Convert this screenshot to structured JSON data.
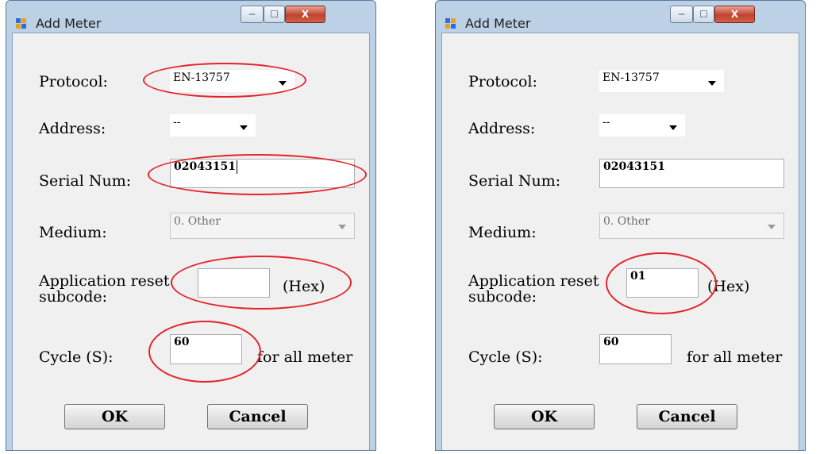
{
  "windows": [
    {
      "title": "Add Meter",
      "controls": {
        "minimize": "─",
        "maximize": "☐",
        "close": "X"
      },
      "protocol": {
        "label": "Protocol:",
        "value": "EN-13757"
      },
      "address": {
        "label": "Address:",
        "value": "--"
      },
      "serial": {
        "label": "Serial Num:",
        "value": "02043151"
      },
      "medium": {
        "label": "Medium:",
        "value": "0. Other"
      },
      "app_reset": {
        "label": "Application reset subcode:",
        "value": "",
        "unit": "(Hex)"
      },
      "cycle": {
        "label": "Cycle (S):",
        "value": "60",
        "suffix": "for all meter"
      },
      "ok_label": "OK",
      "cancel_label": "Cancel"
    },
    {
      "title": "Add Meter",
      "controls": {
        "minimize": "─",
        "maximize": "☐",
        "close": "X"
      },
      "protocol": {
        "label": "Protocol:",
        "value": "EN-13757"
      },
      "address": {
        "label": "Address:",
        "value": "--"
      },
      "serial": {
        "label": "Serial Num:",
        "value": "02043151"
      },
      "medium": {
        "label": "Medium:",
        "value": "0. Other"
      },
      "app_reset": {
        "label": "Application reset subcode:",
        "value": "01",
        "unit": "(Hex)"
      },
      "cycle": {
        "label": "Cycle (S):",
        "value": "60",
        "suffix": "for all meter"
      },
      "ok_label": "OK",
      "cancel_label": "Cancel"
    }
  ],
  "colors": {
    "highlight": "#e3242b",
    "window_frame": "#bcd0e6",
    "client_bg": "#f0f0f0"
  }
}
